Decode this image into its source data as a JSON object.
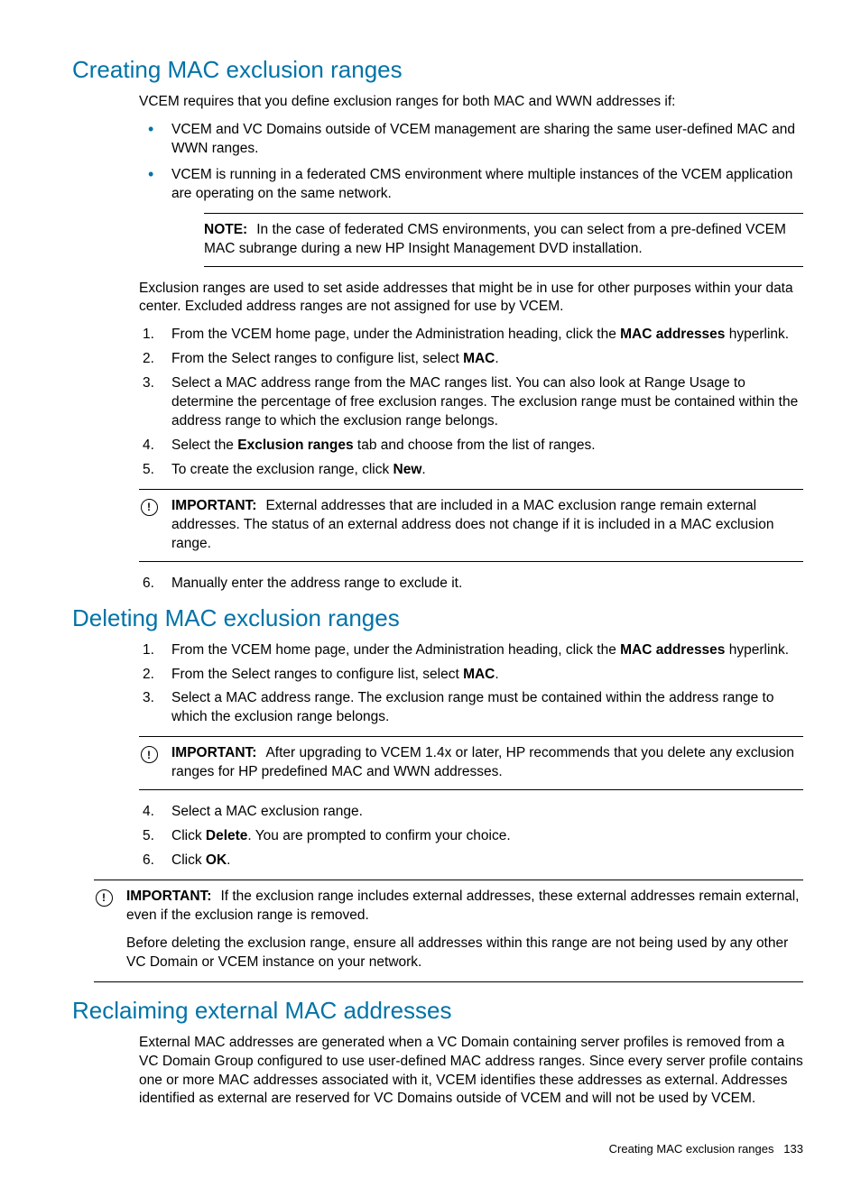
{
  "s1": {
    "heading": "Creating MAC exclusion ranges",
    "intro": "VCEM requires that you define exclusion ranges for both MAC and WWN addresses if:",
    "bullets": [
      "VCEM and VC Domains outside of VCEM management are sharing the same user-defined MAC and WWN ranges.",
      "VCEM is running in a federated CMS environment where multiple instances of the VCEM application are operating on the same network."
    ],
    "note_label": "NOTE:",
    "note_text": "In the case of federated CMS environments, you can select from a pre-defined VCEM MAC subrange during a new HP Insight Management DVD installation.",
    "para2": "Exclusion ranges are used to set aside addresses that might be in use for other purposes within your data center. Excluded address ranges are not assigned for use by VCEM.",
    "steps": {
      "s1a": "From the VCEM home page, under the Administration heading, click the ",
      "s1b": "MAC addresses",
      "s1c": " hyperlink.",
      "s2a": "From the Select ranges to configure list, select ",
      "s2b": "MAC",
      "s2c": ".",
      "s3": "Select a MAC address range from the MAC ranges list. You can also look at Range Usage to determine the percentage of free exclusion ranges. The exclusion range must be contained within the address range to which the exclusion range belongs.",
      "s4a": "Select the ",
      "s4b": "Exclusion ranges",
      "s4c": " tab and choose from the list of ranges.",
      "s5a": "To create the exclusion range, click ",
      "s5b": "New",
      "s5c": ".",
      "s6": "Manually enter the address range to exclude it."
    },
    "important_label": "IMPORTANT:",
    "important_text": "External addresses that are included in a MAC exclusion range remain external addresses. The status of an external address does not change if it is included in a MAC exclusion range."
  },
  "s2": {
    "heading": "Deleting MAC exclusion ranges",
    "steps": {
      "s1a": "From the VCEM home page, under the Administration heading, click the ",
      "s1b": "MAC addresses",
      "s1c": " hyperlink.",
      "s2a": "From the Select ranges to configure list, select ",
      "s2b": "MAC",
      "s2c": ".",
      "s3": "Select a MAC address range. The exclusion range must be contained within the address range to which the exclusion range belongs.",
      "s4": "Select a MAC exclusion range.",
      "s5a": "Click ",
      "s5b": "Delete",
      "s5c": ". You are prompted to confirm your choice.",
      "s6a": "Click ",
      "s6b": "OK",
      "s6c": "."
    },
    "important1_label": "IMPORTANT:",
    "important1_text": "After upgrading to VCEM 1.4x or later, HP recommends that you delete any exclusion ranges for HP predefined MAC and WWN addresses.",
    "important2_label": "IMPORTANT:",
    "important2_text": "If the exclusion range includes external addresses, these external addresses remain external, even if the exclusion range is removed.",
    "important2_para2": "Before deleting the exclusion range, ensure all addresses within this range are not being used by any other VC Domain or VCEM instance on your network."
  },
  "s3": {
    "heading": "Reclaiming external MAC addresses",
    "para": "External MAC addresses are generated when a VC Domain containing server profiles is removed from a VC Domain Group configured to use user-defined MAC address ranges. Since every server profile contains one or more MAC addresses associated with it, VCEM identifies these addresses as external. Addresses identified as external are reserved for VC Domains outside of VCEM and will not be used by VCEM."
  },
  "footer": {
    "title": "Creating MAC exclusion ranges",
    "page": "133"
  }
}
